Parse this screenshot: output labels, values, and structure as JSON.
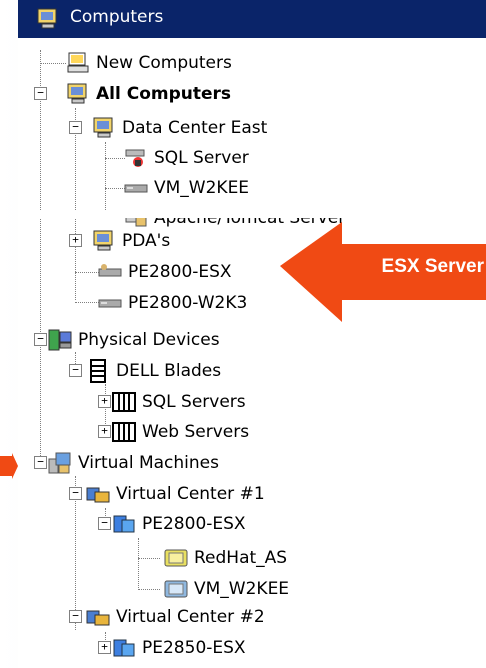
{
  "header": {
    "title": "Computers"
  },
  "tree": [
    {
      "label": "New Computers",
      "icon": "new-computers-icon"
    },
    {
      "label": "All Computers",
      "icon": "computer-group-icon",
      "bold": true
    },
    {
      "label": "Data Center East",
      "icon": "computer-group-icon"
    },
    {
      "label": "SQL Server",
      "icon": "sql-server-icon"
    },
    {
      "label": "VM_W2KEE",
      "icon": "server-icon"
    },
    {
      "label": "Apache/Tomcat Server",
      "icon": "web-server-icon"
    },
    {
      "label": "PDA's",
      "icon": "computer-group-icon"
    },
    {
      "label": "PE2800-ESX",
      "icon": "server-icon"
    },
    {
      "label": "PE2800-W2K3",
      "icon": "server-icon"
    },
    {
      "label": "Physical Devices",
      "icon": "physical-devices-icon"
    },
    {
      "label": "DELL Blades",
      "icon": "blade-chassis-icon"
    },
    {
      "label": "SQL Servers",
      "icon": "blade-rack-icon"
    },
    {
      "label": "Web Servers",
      "icon": "blade-rack-icon"
    },
    {
      "label": "Virtual Machines",
      "icon": "virtual-machines-icon"
    },
    {
      "label": "Virtual Center #1",
      "icon": "virtual-center-icon"
    },
    {
      "label": "PE2800-ESX",
      "icon": "esx-host-icon"
    },
    {
      "label": "RedHat_AS",
      "icon": "vm-icon"
    },
    {
      "label": "VM_W2KEE",
      "icon": "vm-icon"
    },
    {
      "label": "Virtual Center #2",
      "icon": "virtual-center-icon"
    },
    {
      "label": "PE2850-ESX",
      "icon": "esx-host-icon"
    }
  ],
  "callout": {
    "label": "ESX Server",
    "color": "#f04a14"
  },
  "colors": {
    "header_bg": "#0a2469",
    "callout": "#f04a14"
  }
}
